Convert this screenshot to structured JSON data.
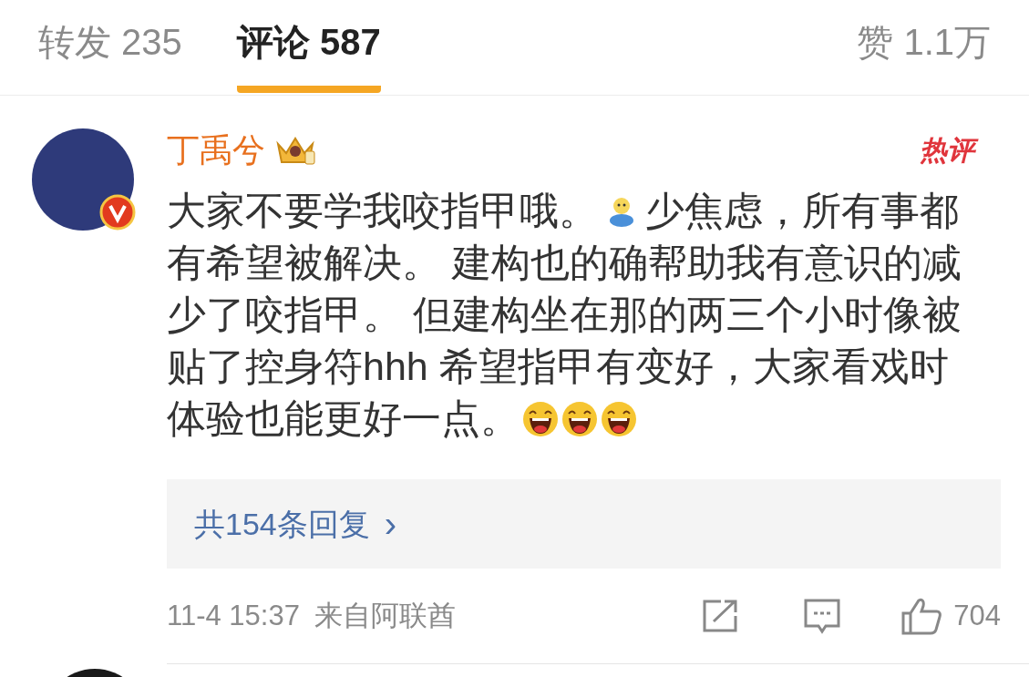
{
  "tabs": [
    {
      "label": "转发 235",
      "selected": false
    },
    {
      "label": "评论 587",
      "selected": true
    },
    {
      "label": "赞 1.1万",
      "selected": false
    }
  ],
  "comment": {
    "user": "丁禹兮",
    "verified": true,
    "hot_label": "热评",
    "content_lines": [
      [
        {
          "kind": "text",
          "text": "大家不要学我咬指甲哦。"
        },
        {
          "kind": "emoji"
        },
        {
          "kind": "text",
          "text": "少焦虑，所有事都"
        }
      ],
      [
        {
          "kind": "text",
          "text": "有希望被解决。 建构也的确帮助我有意识的减"
        }
      ],
      [
        {
          "kind": "text",
          "text": "少了咬指甲。 但建构坐在那的两三个小时像被"
        }
      ],
      [
        {
          "kind": "text",
          "text": "贴了控身符hhh 希望指甲有变好，大家看戏时"
        }
      ],
      [
        {
          "kind": "text",
          "text": "体验也能更好一点。"
        },
        {
          "kind": "laugh"
        },
        {
          "kind": "laugh"
        },
        {
          "kind": "laugh"
        }
      ]
    ],
    "replies_link": "共154条回复",
    "replies_chevron": "›",
    "time": "11-4 15:37",
    "source": "来自阿联酋",
    "likes": "704"
  }
}
